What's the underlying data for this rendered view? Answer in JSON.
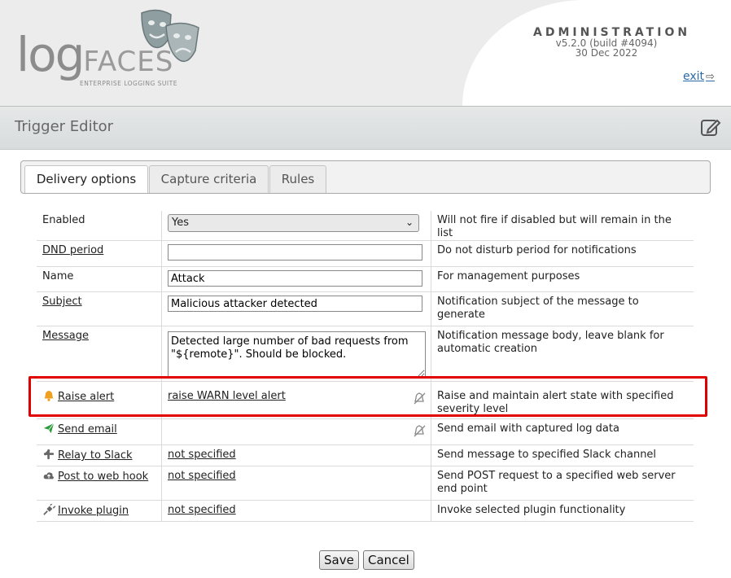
{
  "header": {
    "logo_log": "log",
    "logo_faces": "FACES",
    "logo_subtitle": "ENTERPRISE LOGGING SUITE",
    "admin_title": "ADMINISTRATION",
    "version": "v5.2.0 (build #4094)",
    "date": "30 Dec 2022",
    "exit_label": "exit"
  },
  "titlebar": {
    "title": "Trigger Editor",
    "icon": "edit-icon"
  },
  "tabs": [
    {
      "label": "Delivery options",
      "active": true
    },
    {
      "label": "Capture criteria",
      "active": false
    },
    {
      "label": "Rules",
      "active": false
    }
  ],
  "rows": {
    "enabled": {
      "label": "Enabled",
      "value": "Yes",
      "help": "Will not fire if disabled but will remain in the list"
    },
    "dnd": {
      "label": "DND period",
      "value": "",
      "help": "Do not disturb period for notifications"
    },
    "name": {
      "label": "Name",
      "value": "Attack",
      "help": "For management purposes"
    },
    "subject": {
      "label": "Subject",
      "value": "Malicious attacker detected",
      "help": "Notification subject of the message to generate"
    },
    "message": {
      "label": "Message",
      "value": "Detected large number of bad requests from \"${remote}\". Should be blocked.",
      "help": "Notification message body, leave blank for automatic creation"
    },
    "raise_alert": {
      "label": "Raise alert",
      "value": "raise WARN level alert",
      "help": "Raise and maintain alert state with specified severity level",
      "icon": "bell-icon"
    },
    "send_email": {
      "label": "Send email",
      "value": "",
      "help": "Send email with captured log data",
      "icon": "paper-plane-icon"
    },
    "slack": {
      "label": "Relay to Slack",
      "value": "not specified",
      "help": "Send message to specified Slack channel",
      "icon": "slack-icon"
    },
    "webhook": {
      "label": "Post to web hook",
      "value": "not specified",
      "help": "Send POST request to a specified web server end point",
      "icon": "cloud-upload-icon"
    },
    "plugin": {
      "label": "Invoke plugin",
      "value": "not specified",
      "help": "Invoke selected plugin functionality",
      "icon": "plug-icon"
    }
  },
  "buttons": {
    "save": "Save",
    "cancel": "Cancel"
  },
  "colors": {
    "highlight": "#e10000",
    "bell": "#f0a020",
    "plane": "#2a9a3a",
    "exit_link": "#2a6aa8"
  }
}
